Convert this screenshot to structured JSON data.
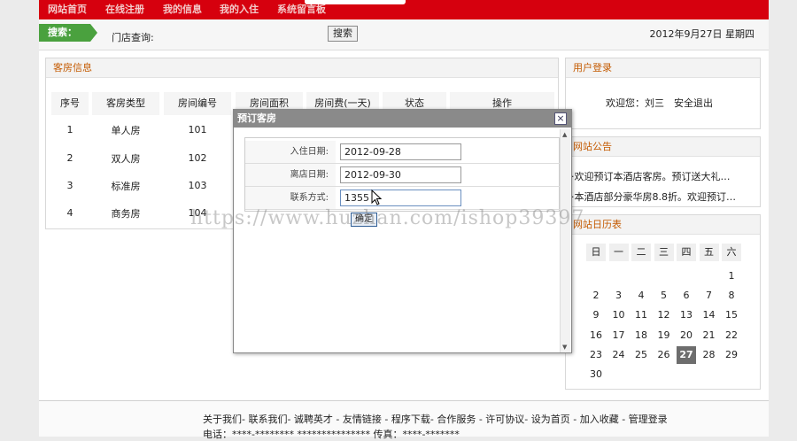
{
  "nav": {
    "items": [
      "网站首页",
      "在线注册",
      "我的信息",
      "我的入住",
      "系统留言板"
    ]
  },
  "search": {
    "tag": "搜索：",
    "label": "门店查询:",
    "button": "搜索",
    "date": "2012年9月27日 星期四"
  },
  "rooms": {
    "title": "客房信息",
    "columns": [
      "序号",
      "客房类型",
      "房间编号",
      "房间面积",
      "房间费(一天)",
      "状态",
      "操作"
    ],
    "rows": [
      {
        "no": "1",
        "type": "单人房",
        "room": "101"
      },
      {
        "no": "2",
        "type": "双人房",
        "room": "102"
      },
      {
        "no": "3",
        "type": "标准房",
        "room": "103"
      },
      {
        "no": "4",
        "type": "商务房",
        "room": "104"
      }
    ]
  },
  "user": {
    "title": "用户登录",
    "welcome": "欢迎您：刘三",
    "logout": "安全退出"
  },
  "notice": {
    "title": "网站公告",
    "items": [
      "·欢迎预订本酒店客房。预订送大礼…",
      "·本酒店部分豪华房8.8折。欢迎预订…"
    ]
  },
  "calendar": {
    "title": "网站日历表",
    "weekdays": [
      "日",
      "一",
      "二",
      "三",
      "四",
      "五",
      "六"
    ],
    "today": "27"
  },
  "footer": {
    "links": "关于我们- 联系我们- 诚聘英才 - 友情链接 - 程序下载- 合作服务 - 许可协议- 设为首页 - 加入收藏 - 管理登录",
    "contact": "电话：****-******** *************** 传真：****-*******"
  },
  "modal": {
    "title": "预订客房",
    "close": "×",
    "checkin_label": "入住日期:",
    "checkin_value": "2012-09-28",
    "checkout_label": "离店日期:",
    "checkout_value": "2012-09-30",
    "contact_label": "联系方式:",
    "contact_value": "1355",
    "submit": "确定"
  },
  "watermark": "https://www.huzhan.com/ishop39397"
}
